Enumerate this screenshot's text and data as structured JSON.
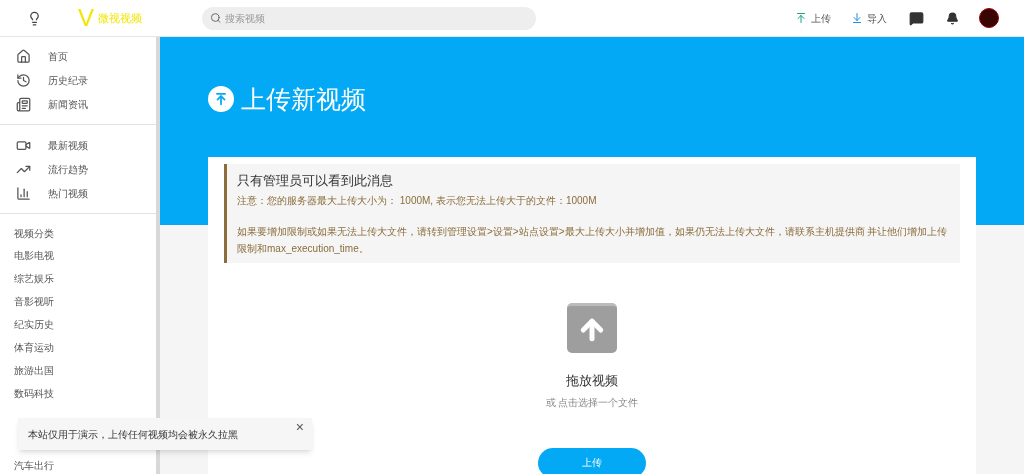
{
  "header": {
    "logo_letter": "V",
    "logo_text": "微视视频",
    "search": {
      "placeholder": "搜索视频"
    },
    "actions": [
      {
        "kind": "upload",
        "label": "上传"
      },
      {
        "kind": "import",
        "label": "导入"
      }
    ]
  },
  "sidebar": {
    "main_items": [
      {
        "label": "首页"
      },
      {
        "label": "历史纪录"
      },
      {
        "label": "新闻资讯"
      }
    ],
    "video_items": [
      {
        "label": "最新视频"
      },
      {
        "label": "流行趋势"
      },
      {
        "label": "热门视频"
      }
    ],
    "category_heading": "视频分类",
    "categories": [
      "电影电视",
      "综艺娱乐",
      "音影视听",
      "纪实历史",
      "体育运动",
      "旅游出国",
      "数码科技"
    ],
    "categories_after_toast": [
      "汽车出行"
    ]
  },
  "page": {
    "title": "上传新视频",
    "notice": {
      "title": "只有管理员可以看到此消息",
      "line_1": "注意：您的服务器最大上传大小为： 1000M, 表示您无法上传大于的文件：1000M",
      "line_2": "如果要增加限制或如果无法上传大文件，请转到管理设置>设置>站点设置>最大上传大小并增加值，如果仍无法上传大文件，请联系主机提供商 并让他们增加上传限制和max_execution_time。"
    },
    "dropzone": {
      "title": "拖放视频",
      "subtitle": "或 点击选择一个文件"
    },
    "upload_button": "上传"
  },
  "toast": {
    "text": "本站仅用于演示，上传任何视频均会被永久拉黑",
    "close": "×"
  }
}
